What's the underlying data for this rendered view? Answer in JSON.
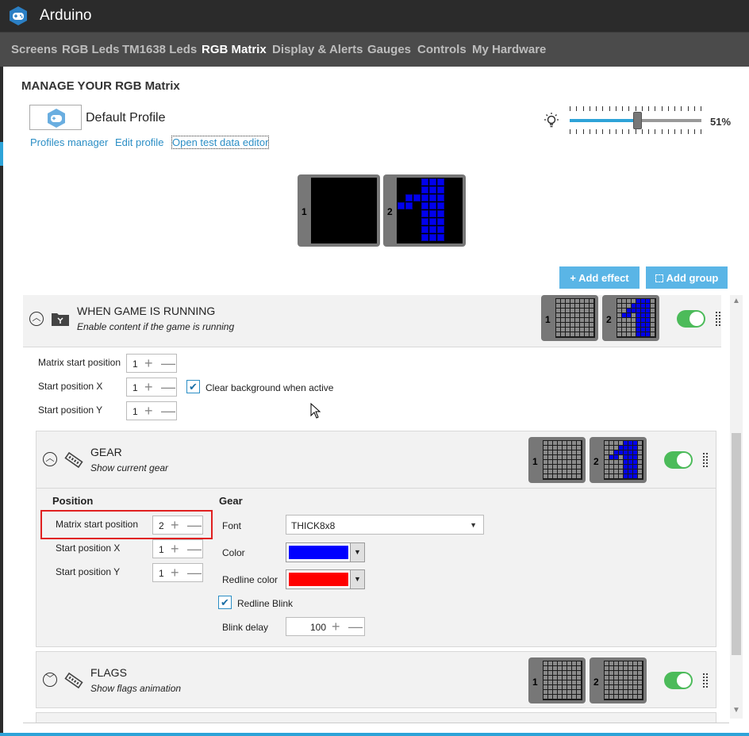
{
  "app": {
    "title": "Arduino",
    "icon": "gamepad-icon"
  },
  "nav": {
    "items": [
      "Screens",
      "RGB Leds",
      "TM1638 Leds",
      "RGB Matrix",
      "Display & Alerts",
      "Gauges",
      "Controls",
      "My Hardware"
    ],
    "active": "RGB Matrix"
  },
  "page": {
    "title": "MANAGE YOUR RGB Matrix"
  },
  "profile": {
    "name": "Default Profile",
    "links": [
      "Profiles manager",
      "Edit profile",
      "Open test data editor"
    ]
  },
  "brightness": {
    "value_label": "51%",
    "fraction": 0.51
  },
  "preview": {
    "matrix_labels": [
      "1",
      "2"
    ]
  },
  "buttons": {
    "add_effect": "+ Add effect",
    "add_group": "Add group"
  },
  "group": {
    "title": "WHEN GAME IS RUNNING",
    "subtitle": "Enable content if the game is running",
    "enabled": true,
    "matrix_labels": [
      "1",
      "2"
    ],
    "settings": {
      "matrix_start_label": "Matrix start position",
      "matrix_start_value": "1",
      "start_x_label": "Start position X",
      "start_x_value": "1",
      "start_y_label": "Start position Y",
      "start_y_value": "1",
      "clear_bg_label": "Clear background when active",
      "clear_bg_checked": true
    }
  },
  "gear": {
    "title": "GEAR",
    "subtitle": "Show current gear",
    "enabled": true,
    "matrix_labels": [
      "1",
      "2"
    ],
    "position": {
      "heading": "Position",
      "matrix_start_label": "Matrix start position",
      "matrix_start_value": "2",
      "start_x_label": "Start position X",
      "start_x_value": "1",
      "start_y_label": "Start position Y",
      "start_y_value": "1"
    },
    "settings": {
      "heading": "Gear",
      "font_label": "Font",
      "font_value": "THICK8x8",
      "color_label": "Color",
      "color_value": "#0000ff",
      "redline_color_label": "Redline color",
      "redline_color_value": "#ff0000",
      "redline_blink_label": "Redline Blink",
      "redline_blink_checked": true,
      "blink_delay_label": "Blink delay",
      "blink_delay_value": "100"
    }
  },
  "flags": {
    "title": "FLAGS",
    "subtitle": "Show flags animation",
    "enabled": true,
    "matrix_labels": [
      "1",
      "2"
    ]
  },
  "colors": {
    "accent": "#2ea3d8",
    "toggle_on": "#4cbb5a",
    "matrix_led": "#0000ee",
    "highlight": "#e02020"
  }
}
